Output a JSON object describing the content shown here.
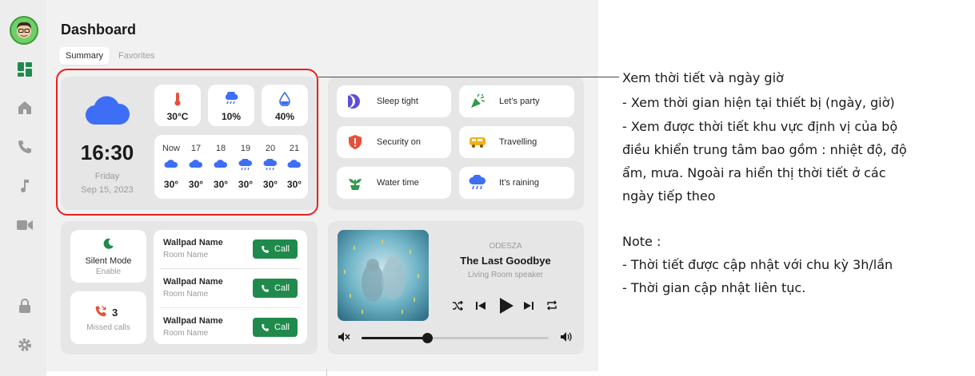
{
  "header": {
    "title": "Dashboard"
  },
  "tabs": [
    {
      "label": "Summary",
      "active": true
    },
    {
      "label": "Favorites",
      "active": false
    }
  ],
  "sidebar": {
    "avatar": "avatar-face",
    "items": [
      {
        "icon": "dashboard-icon",
        "active": true
      },
      {
        "icon": "home-icon",
        "active": false
      },
      {
        "icon": "phone-icon",
        "active": false
      },
      {
        "icon": "music-note-icon",
        "active": false
      },
      {
        "icon": "video-camera-icon",
        "active": false
      },
      {
        "icon": "lock-icon",
        "active": false
      },
      {
        "icon": "gear-icon",
        "active": false
      }
    ]
  },
  "weather": {
    "icon": "cloud-icon",
    "time": "16:30",
    "day": "Friday",
    "date": "Sep 15, 2023",
    "stats": [
      {
        "icon": "thermometer-icon",
        "value": "30°C"
      },
      {
        "icon": "rain-icon",
        "value": "10%"
      },
      {
        "icon": "humidity-drop-icon",
        "value": "40%"
      }
    ],
    "forecast": [
      {
        "day": "Now",
        "icon": "cloud-icon",
        "temp": "30°"
      },
      {
        "day": "17",
        "icon": "cloud-icon",
        "temp": "30°"
      },
      {
        "day": "18",
        "icon": "cloud-icon",
        "temp": "30°"
      },
      {
        "day": "19",
        "icon": "rain-cloud-icon",
        "temp": "30°"
      },
      {
        "day": "20",
        "icon": "rain-cloud-icon",
        "temp": "30°"
      },
      {
        "day": "21",
        "icon": "cloud-icon",
        "temp": "30°"
      }
    ]
  },
  "scenes": [
    {
      "label": "Sleep tight",
      "icon": "moon-icon"
    },
    {
      "label": "Let’s party",
      "icon": "party-popper-icon"
    },
    {
      "label": "Security on",
      "icon": "shield-alert-icon"
    },
    {
      "label": "Travelling",
      "icon": "car-icon"
    },
    {
      "label": "Water time",
      "icon": "plant-icon"
    },
    {
      "label": "It’s raining",
      "icon": "rain-cloud-icon"
    }
  ],
  "silent_mode": {
    "label": "Silent Mode",
    "status": "Enable",
    "icon": "moon-icon"
  },
  "missed_calls": {
    "count": "3",
    "label": "Missed calls",
    "icon": "missed-call-icon"
  },
  "wallpads": [
    {
      "name": "Wallpad Name",
      "room": "Room Name",
      "button": "Call"
    },
    {
      "name": "Wallpad Name",
      "room": "Room Name",
      "button": "Call"
    },
    {
      "name": "Wallpad Name",
      "room": "Room Name",
      "button": "Call"
    }
  ],
  "player": {
    "artist": "ODESZA",
    "track": "The Last Goodbye",
    "device": "Living Room speaker",
    "volume": 0.35,
    "accent": "#1f8a4c"
  },
  "annotation": {
    "lines": [
      "Xem thời tiết và ngày giờ",
      "- Xem thời gian hiện tại thiết bị (ngày, giờ)",
      "- Xem được thời tiết khu vực định vị của bộ",
      "điều khiển trung tâm bao gồm : nhiệt độ, độ",
      "ẩm, mưa. Ngoài ra hiển thị thời tiết ở các",
      "ngày tiếp theo"
    ],
    "note_title": "Note :",
    "notes": [
      "- Thời tiết được cập nhật với chu kỳ 3h/lần",
      "- Thời gian cập nhật liên tục."
    ]
  },
  "colors": {
    "weather_blue": "#3d6ef5",
    "call_green": "#1f8a4c",
    "highlight_red": "#e8201f"
  }
}
